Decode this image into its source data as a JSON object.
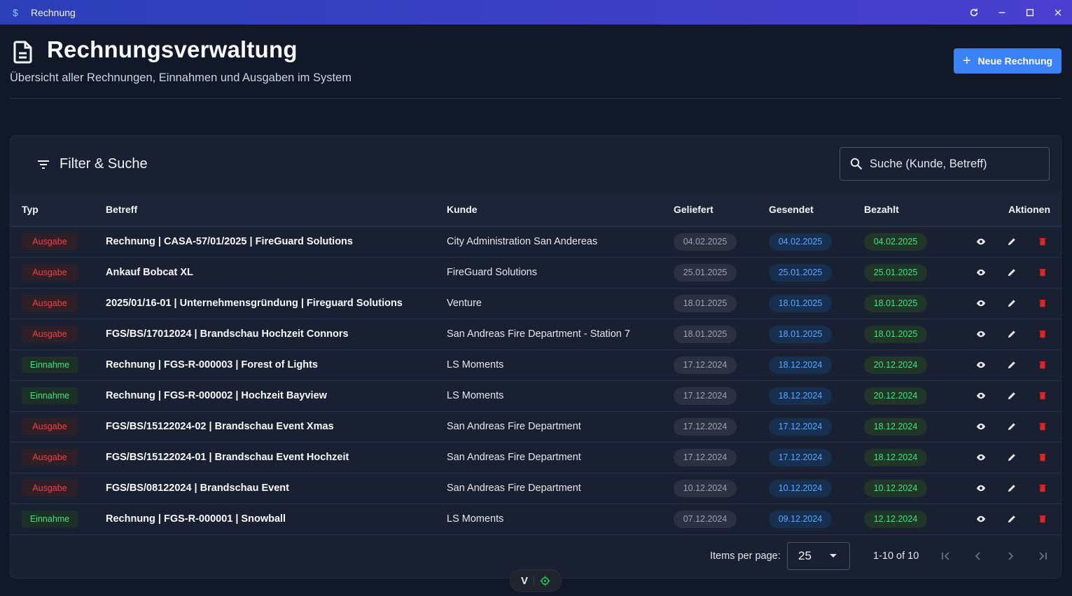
{
  "window": {
    "title": "Rechnung",
    "icon": "dollar-icon"
  },
  "header": {
    "title": "Rechnungsverwaltung",
    "subtitle": "Übersicht aller Rechnungen, Einnahmen und Ausgaben im System",
    "new_button": "Neue Rechnung"
  },
  "filter": {
    "title": "Filter & Suche",
    "search_placeholder": "Suche (Kunde, Betreff)"
  },
  "table": {
    "columns": [
      "Typ",
      "Betreff",
      "Kunde",
      "Geliefert",
      "Gesendet",
      "Bezahlt",
      "Aktionen"
    ],
    "rows": [
      {
        "typ": "Ausgabe",
        "betreff": "Rechnung | CASA-57/01/2025 | FireGuard Solutions",
        "kunde": "City Administration San Andereas",
        "geliefert": "04.02.2025",
        "gesendet": "04.02.2025",
        "bezahlt": "04.02.2025"
      },
      {
        "typ": "Ausgabe",
        "betreff": "Ankauf Bobcat XL",
        "kunde": "FireGuard Solutions",
        "geliefert": "25.01.2025",
        "gesendet": "25.01.2025",
        "bezahlt": "25.01.2025"
      },
      {
        "typ": "Ausgabe",
        "betreff": "2025/01/16-01 | Unternehmensgründung | Fireguard Solutions",
        "kunde": "Venture",
        "geliefert": "18.01.2025",
        "gesendet": "18.01.2025",
        "bezahlt": "18.01.2025"
      },
      {
        "typ": "Ausgabe",
        "betreff": "FGS/BS/17012024 | Brandschau Hochzeit Connors",
        "kunde": "San Andreas Fire Department - Station 7",
        "geliefert": "18.01.2025",
        "gesendet": "18.01.2025",
        "bezahlt": "18.01.2025"
      },
      {
        "typ": "Einnahme",
        "betreff": "Rechnung | FGS-R-000003 | Forest of Lights",
        "kunde": "LS Moments",
        "geliefert": "17.12.2024",
        "gesendet": "18.12.2024",
        "bezahlt": "20.12.2024"
      },
      {
        "typ": "Einnahme",
        "betreff": "Rechnung | FGS-R-000002 | Hochzeit Bayview",
        "kunde": "LS Moments",
        "geliefert": "17.12.2024",
        "gesendet": "18.12.2024",
        "bezahlt": "20.12.2024"
      },
      {
        "typ": "Ausgabe",
        "betreff": "FGS/BS/15122024-02 | Brandschau Event Xmas",
        "kunde": "San Andreas Fire Department",
        "geliefert": "17.12.2024",
        "gesendet": "17.12.2024",
        "bezahlt": "18.12.2024"
      },
      {
        "typ": "Ausgabe",
        "betreff": "FGS/BS/15122024-01 | Brandschau Event Hochzeit",
        "kunde": "San Andreas Fire Department",
        "geliefert": "17.12.2024",
        "gesendet": "17.12.2024",
        "bezahlt": "18.12.2024"
      },
      {
        "typ": "Ausgabe",
        "betreff": "FGS/BS/08122024 | Brandschau Event",
        "kunde": "San Andreas Fire Department",
        "geliefert": "10.12.2024",
        "gesendet": "10.12.2024",
        "bezahlt": "10.12.2024"
      },
      {
        "typ": "Einnahme",
        "betreff": "Rechnung | FGS-R-000001 | Snowball",
        "kunde": "LS Moments",
        "geliefert": "07.12.2024",
        "gesendet": "09.12.2024",
        "bezahlt": "12.12.2024"
      }
    ]
  },
  "pagination": {
    "items_per_page_label": "Items per page:",
    "items_per_page": "25",
    "range": "1-10 of 10"
  },
  "colors": {
    "accent": "#3b82f6",
    "ausgabe": "#ef4444",
    "einnahme": "#4ade80",
    "gesendet": "#60a5fa",
    "delete": "#dc2626"
  }
}
